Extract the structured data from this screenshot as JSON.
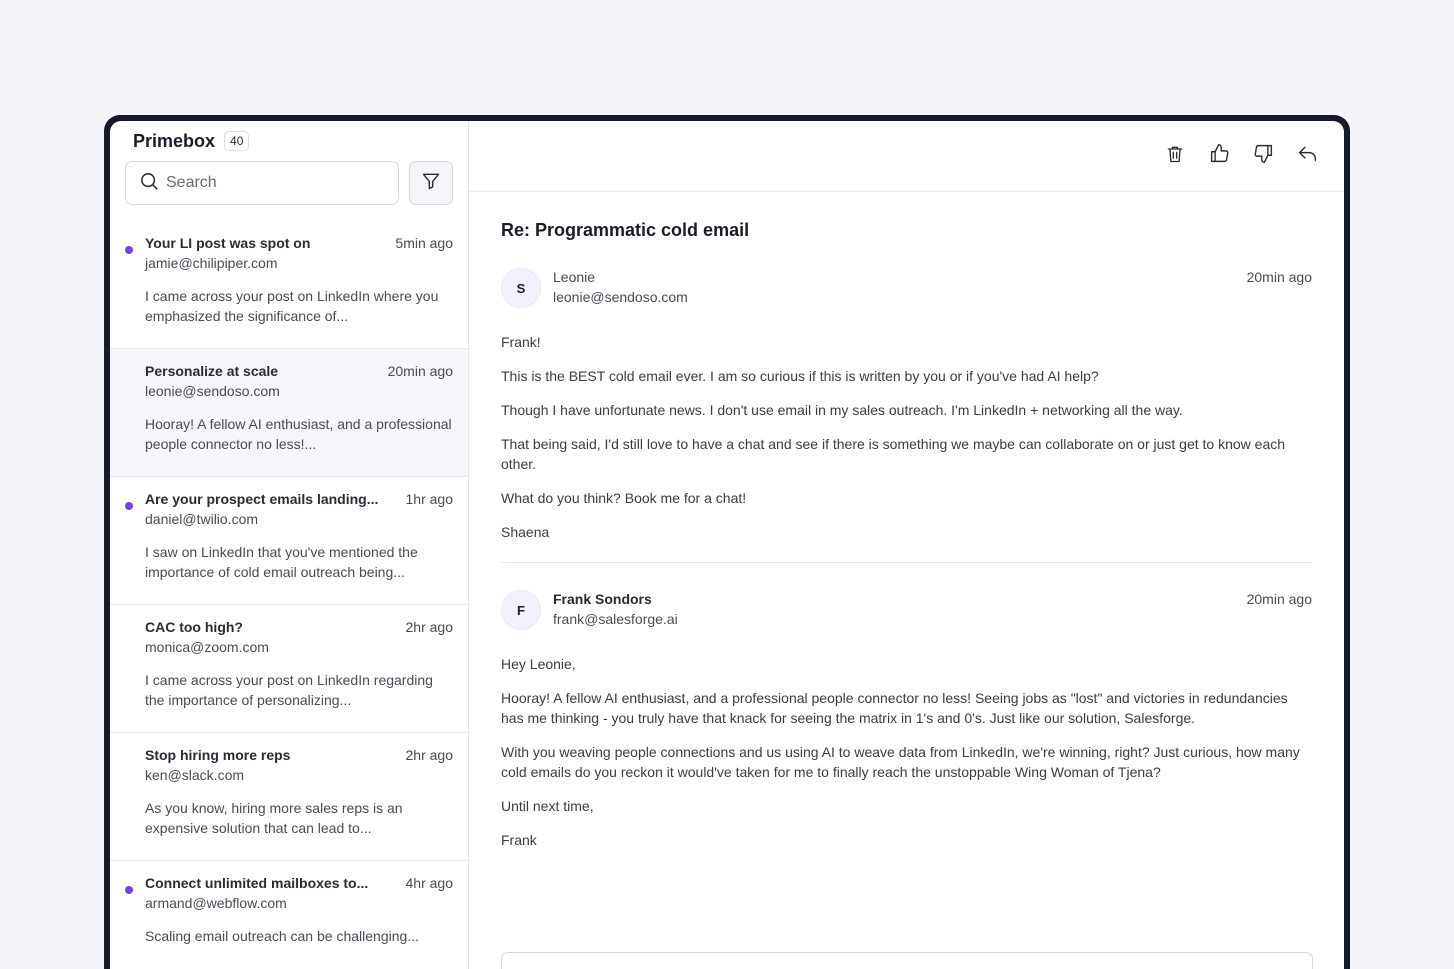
{
  "inbox": {
    "title": "Primebox",
    "count": "40",
    "search_placeholder": "Search"
  },
  "emails": [
    {
      "subject": "Your LI post was spot on",
      "time": "5min ago",
      "from": "jamie@chilipiper.com",
      "preview": "I came across your post on LinkedIn where you emphasized the significance of...",
      "unread": true
    },
    {
      "subject": "Personalize at scale",
      "time": "20min ago",
      "from": "leonie@sendoso.com",
      "preview": "Hooray! A fellow AI enthusiast, and a professional people connector no less!...",
      "unread": false
    },
    {
      "subject": "Are your prospect emails landing...",
      "time": "1hr ago",
      "from": "daniel@twilio.com",
      "preview": "I saw on LinkedIn that you've mentioned the importance of cold email outreach being...",
      "unread": true
    },
    {
      "subject": "CAC too high?",
      "time": "2hr ago",
      "from": "monica@zoom.com",
      "preview": "I came across your post on LinkedIn regarding the importance of personalizing...",
      "unread": false
    },
    {
      "subject": "Stop hiring more reps",
      "time": "2hr ago",
      "from": "ken@slack.com",
      "preview": "As you know, hiring more sales reps is an expensive solution that can lead to...",
      "unread": false
    },
    {
      "subject": "Connect unlimited mailboxes to...",
      "time": "4hr ago",
      "from": "armand@webflow.com",
      "preview": "Scaling email outreach can be challenging...",
      "unread": true
    }
  ],
  "toolbar": {
    "icons": [
      "trash-icon",
      "thumbs-up-icon",
      "thumbs-down-icon",
      "reply-icon"
    ]
  },
  "thread": {
    "subject": "Re: Programmatic cold email",
    "messages": [
      {
        "initial": "S",
        "name": "Leonie",
        "email": "leonie@sendoso.com",
        "time": "20min ago",
        "paragraphs": [
          "Frank!",
          "This is the BEST cold email ever. I am so curious if this is written by you or if you've had AI help?",
          "Though I have unfortunate news. I don't use email in my sales outreach. I'm LinkedIn + networking all the way.",
          "That being said, I'd still love to have a chat and see if there is something we maybe can collaborate on or just get to know each other.",
          "What do you think? Book me for a chat!",
          "Shaena"
        ]
      },
      {
        "initial": "F",
        "name": "Frank Sondors",
        "email": "frank@salesforge.ai",
        "time": "20min ago",
        "paragraphs": [
          "Hey Leonie,",
          "Hooray! A fellow AI enthusiast, and a professional people connector no less! Seeing jobs as \"lost\" and victories in redundancies has me thinking - you truly have that knack for seeing the matrix in 1's and 0's. Just like our solution, Salesforge.",
          "With you weaving people connections and us using AI to weave data from LinkedIn, we're winning, right? Just curious, how many cold emails do you reckon it would've taken for me to finally reach the unstoppable Wing Woman of Tjena?",
          "Until next time,",
          "Frank"
        ]
      }
    ]
  },
  "colors": {
    "accent": "#7b3fe4",
    "frame": "#171a2a",
    "background": "#f4f4f9"
  }
}
